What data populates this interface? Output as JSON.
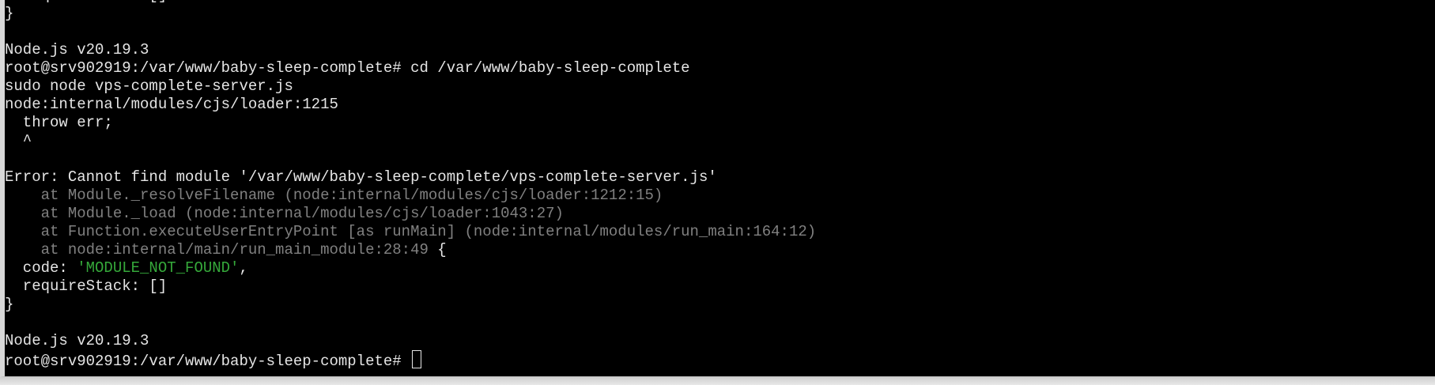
{
  "terminal": {
    "lines": [
      {
        "text": "  requireStack: []",
        "kind": "normal"
      },
      {
        "text": "}",
        "kind": "normal"
      },
      {
        "text": "",
        "kind": "normal"
      },
      {
        "text": "Node.js v20.19.3",
        "kind": "normal"
      },
      {
        "text": "root@srv902919:/var/www/baby-sleep-complete# cd /var/www/baby-sleep-complete",
        "kind": "normal"
      },
      {
        "text": "sudo node vps-complete-server.js",
        "kind": "normal"
      },
      {
        "text": "node:internal/modules/cjs/loader:1215",
        "kind": "normal"
      },
      {
        "text": "  throw err;",
        "kind": "normal"
      },
      {
        "text": "  ^",
        "kind": "normal"
      },
      {
        "text": "",
        "kind": "normal"
      },
      {
        "text": "Error: Cannot find module '/var/www/baby-sleep-complete/vps-complete-server.js'",
        "kind": "normal"
      },
      {
        "text": "    at Module._resolveFilename (node:internal/modules/cjs/loader:1212:15)",
        "kind": "trace"
      },
      {
        "text": "    at Module._load (node:internal/modules/cjs/loader:1043:27)",
        "kind": "trace"
      },
      {
        "text": "    at Function.executeUserEntryPoint [as runMain] (node:internal/modules/run_main:164:12)",
        "kind": "trace"
      },
      {
        "text": "    at node:internal/main/run_main_module:28:49",
        "kind": "trace",
        "suffix": " {"
      },
      {
        "text": "  code: ",
        "kind": "normal",
        "str": "'MODULE_NOT_FOUND'",
        "suffix": ","
      },
      {
        "text": "  requireStack: []",
        "kind": "normal"
      },
      {
        "text": "}",
        "kind": "normal"
      },
      {
        "text": "",
        "kind": "normal"
      },
      {
        "text": "Node.js v20.19.3",
        "kind": "normal"
      },
      {
        "text": "root@srv902919:/var/www/baby-sleep-complete# ",
        "kind": "prompt"
      }
    ]
  },
  "colors": {
    "background": "#000000",
    "foreground": "#e5e5e5",
    "trace": "#808080",
    "string": "#35a83a"
  }
}
